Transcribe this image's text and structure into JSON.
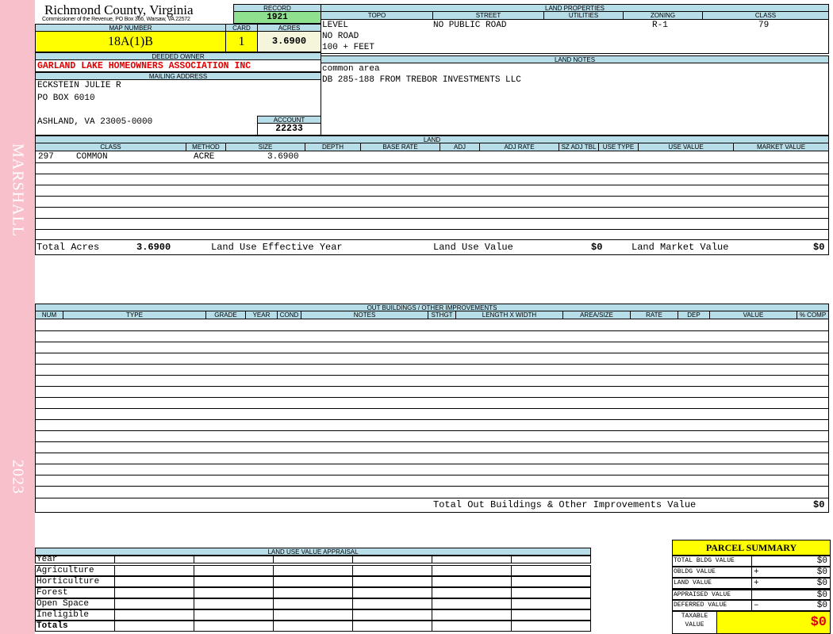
{
  "side": {
    "top": "MARSHALL",
    "bottom": "2023"
  },
  "header": {
    "county": "Richmond County, Virginia",
    "commissioner": "Commissioner of the Revenue, PO Box 366, Warsaw, VA 22572"
  },
  "record": {
    "label": "RECORD",
    "value": "1921"
  },
  "map": {
    "label": "MAP NUMBER",
    "value": "18A(1)B"
  },
  "card": {
    "label": "CARD",
    "value": "1"
  },
  "acres": {
    "label": "ACRES",
    "value": "3.6900"
  },
  "owner": {
    "label": "DEEDED OWNER",
    "value": "GARLAND LAKE HOMEOWNERS ASSOCIATION INC"
  },
  "mailing": {
    "label": "MAILING ADDRESS",
    "line1": "ECKSTEIN JULIE R",
    "line2": "PO BOX 6010",
    "line3": "ASHLAND, VA 23005-0000"
  },
  "account": {
    "label": "ACCOUNT",
    "value": "22233"
  },
  "land_props": {
    "label": "LAND PROPERTIES",
    "cols": [
      "TOPO",
      "STREET",
      "UTILITIES",
      "ZONING",
      "CLASS"
    ],
    "topo1": "LEVEL",
    "topo2": "NO ROAD",
    "topo3": "100 + FEET",
    "street": "NO PUBLIC ROAD",
    "zoning": "R-1",
    "class": "79"
  },
  "land_notes": {
    "label": "LAND NOTES",
    "line1": "common area",
    "line2": "DB 285-188 FROM TREBOR INVESTMENTS LLC"
  },
  "land": {
    "label": "LAND",
    "cols": [
      "CLASS",
      "METHOD",
      "SIZE",
      "DEPTH",
      "BASE RATE",
      "ADJ",
      "ADJ RATE",
      "SZ ADJ TBL",
      "USE TYPE",
      "USE VALUE",
      "MARKET VALUE"
    ],
    "row": {
      "class_code": "297",
      "class_name": "COMMON",
      "method": "ACRE",
      "size": "3.6900"
    },
    "total_acres_label": "Total Acres",
    "total_acres": "3.6900",
    "effective_year_label": "Land Use Effective Year",
    "use_value_label": "Land Use Value",
    "use_value": "$0",
    "market_value_label": "Land Market Value",
    "market_value": "$0"
  },
  "outbuildings": {
    "label": "OUT BUILDINGS / OTHER IMPROVEMENTS",
    "cols": [
      "NUM",
      "TYPE",
      "GRADE",
      "YEAR",
      "COND",
      "NOTES",
      "STHGT",
      "LENGTH X WIDTH",
      "AREA/SIZE",
      "RATE",
      "DEP",
      "VALUE",
      "% COMP"
    ],
    "total_label": "Total Out Buildings & Other Improvements Value",
    "total": "$0"
  },
  "luva": {
    "label": "LAND USE VALUE APPRAISAL",
    "rows": [
      "Year",
      "Agriculture",
      "Horticulture",
      "Forest",
      "Open Space",
      "Ineligible",
      "Totals"
    ]
  },
  "summary": {
    "title": "PARCEL SUMMARY",
    "rows": [
      {
        "label": "TOTAL BLDG VALUE",
        "op": "",
        "value": "$0"
      },
      {
        "label": "OBLDG VALUE",
        "op": "+",
        "value": "$0"
      },
      {
        "label": "LAND VALUE",
        "op": "+",
        "value": "$0"
      },
      {
        "label": "APPRAISED VALUE",
        "op": "",
        "value": "$0"
      },
      {
        "label": "DEFERRED VALUE",
        "op": "–",
        "value": "$0"
      }
    ],
    "taxable_label1": "TAXABLE",
    "taxable_label2": "VALUE",
    "taxable": "$0"
  }
}
